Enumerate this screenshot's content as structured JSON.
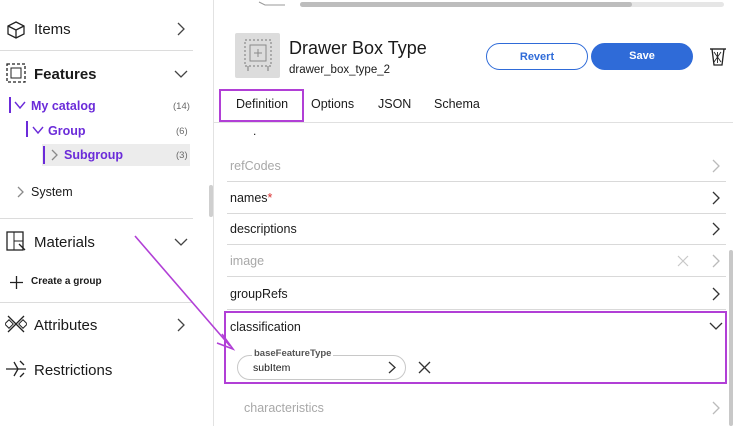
{
  "sidebar": {
    "items_label": "Items",
    "features_label": "Features",
    "tree": [
      {
        "label": "My catalog",
        "count": "(14)"
      },
      {
        "label": "Group",
        "count": "(6)"
      },
      {
        "label": "Subgroup",
        "count": "(3)"
      }
    ],
    "system_label": "System",
    "materials_label": "Materials",
    "create_group_label": "Create a group",
    "attributes_label": "Attributes",
    "restrictions_label": "Restrictions"
  },
  "header": {
    "title": "Drawer Box Type",
    "subtitle": "drawer_box_type_2",
    "revert_label": "Revert",
    "save_label": "Save",
    "top_stub": ""
  },
  "tabs": [
    "Definition",
    "Options",
    "JSON",
    "Schema"
  ],
  "rows": {
    "partial_dot": ".",
    "refcodes": "refCodes",
    "names": "names",
    "names_required": "*",
    "descriptions": "descriptions",
    "image": "image",
    "grouprefs": "groupRefs",
    "classification": "classification",
    "characteristics": "characteristics"
  },
  "classification_field": {
    "legend": "baseFeatureType",
    "value": "subItem"
  },
  "colors": {
    "accent": "#2f6bd8",
    "highlight": "#b13fd6",
    "tree": "#6b2bd9"
  }
}
